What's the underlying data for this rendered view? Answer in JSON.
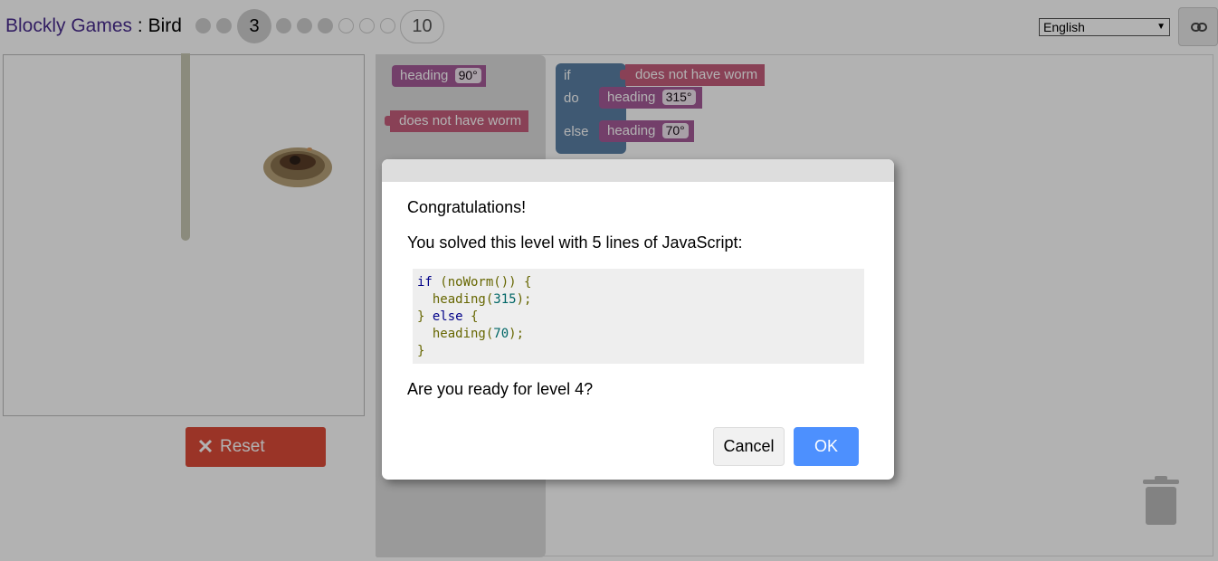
{
  "header": {
    "app_name": "Blockly Games",
    "separator": " : ",
    "game_name": "Bird",
    "current_level": "3",
    "last_level": "10",
    "language": "English"
  },
  "game": {
    "reset_label": "Reset"
  },
  "workspace": {
    "flyout_heading_label": "heading",
    "flyout_heading_value": "90°",
    "flyout_worm_label": "does not have worm",
    "if_label": "if",
    "do_label": "do",
    "else_label": "else",
    "cond_label": "does not have worm",
    "do_heading_label": "heading",
    "do_heading_value": "315°",
    "else_heading_label": "heading",
    "else_heading_value": "70°"
  },
  "dialog": {
    "title": "Congratulations!",
    "message": "You solved this level with 5 lines of JavaScript:",
    "code": {
      "l1_kw": "if",
      "l1_rest": " (noWorm()) {",
      "l2_fn": "  heading(",
      "l2_num": "315",
      "l2_end": ");",
      "l3_brace": "} ",
      "l3_kw": "else",
      "l3_end": " {",
      "l4_fn": "  heading(",
      "l4_num": "70",
      "l4_end": ");",
      "l5": "}"
    },
    "question": "Are you ready for level 4?",
    "cancel_label": "Cancel",
    "ok_label": "OK"
  },
  "colors": {
    "heading_block": "#a55b99",
    "worm_block": "#c55e7c",
    "if_block": "#5b80a5",
    "reset_button": "#dd4b39",
    "ok_button": "#4d90fe"
  }
}
